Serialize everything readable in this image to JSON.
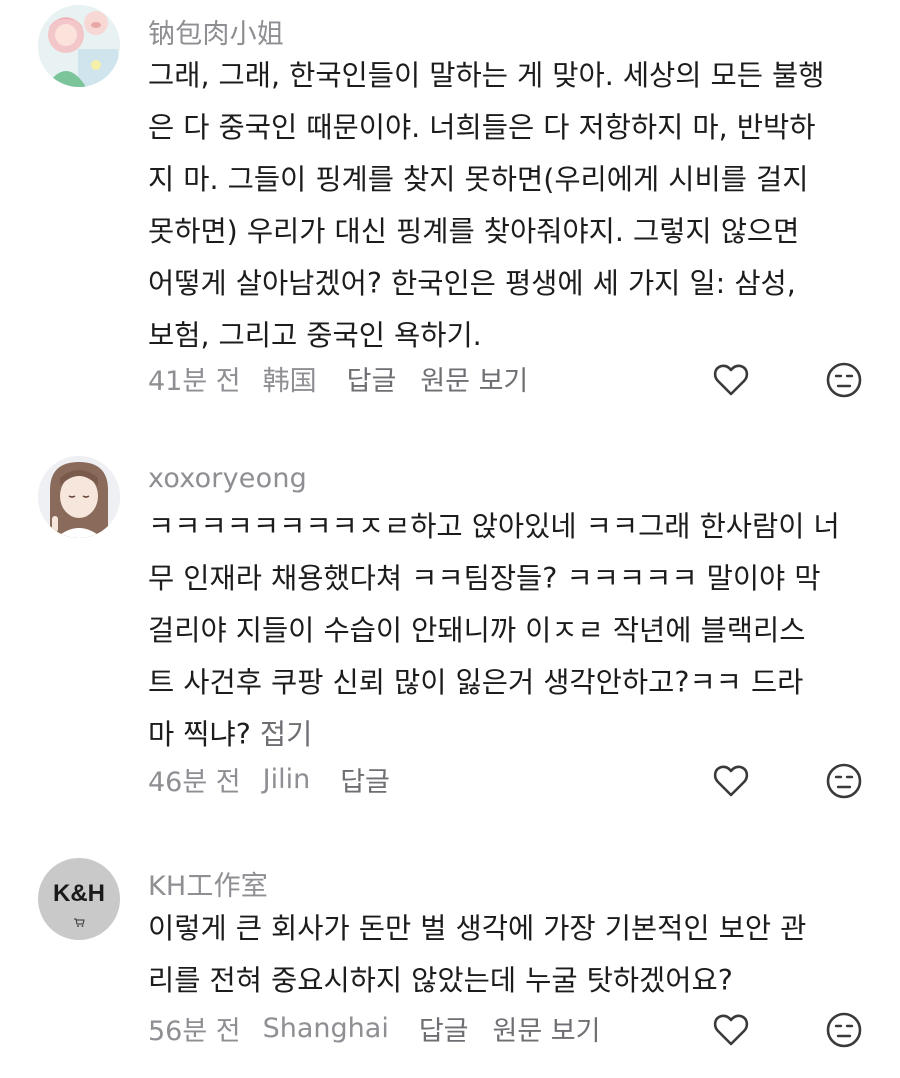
{
  "comments": [
    {
      "username": "钠包肉小姐",
      "lines": [
        "그래, 그래, 한국인들이 말하는 게 맞아. 세상의 모든 불행",
        "은 다 중국인 때문이야. 너희들은 다 저항하지 마, 반박하",
        "지 마. 그들이 핑계를 찾지 못하면(우리에게 시비를 걸지",
        "못하면) 우리가 대신 핑계를 찾아줘야지. 그렇지 않으면",
        "어떻게 살아남겠어? 한국인은 평생에 세 가지 일: 삼성,",
        "보험, 그리고 중국인 욕하기."
      ],
      "time": "41분 전",
      "location": "韩国",
      "reply": "답글",
      "original": "원문 보기"
    },
    {
      "username": "xoxoryeong",
      "lines": [
        "ㅋㅋㅋㅋㅋㅋㅋㅋㅈㄹ하고 앉아있네 ㅋㅋ그래 한사람이 너",
        "무 인재라 채용했다쳐 ㅋㅋ팀장들? ㅋㅋㅋㅋㅋ 말이야 막",
        "걸리야 지들이 수습이 안돼니까 이ㅈㄹ 작년에 블랙리스",
        "트 사건후 쿠팡 신뢰 많이 잃은거 생각안하고?ㅋㅋ 드라",
        "마 찍냐?"
      ],
      "fold": "접기",
      "time": "46분 전",
      "location": "Jilin",
      "reply": "답글"
    },
    {
      "username": "KH工作室",
      "avatar_text": "K&H",
      "lines": [
        "이렇게 큰 회사가 돈만 벌 생각에 가장 기본적인 보안 관",
        "리를 전혀 중요시하지 않았는데 누굴 탓하겠어요?"
      ],
      "time": "56분 전",
      "location": "Shanghai",
      "reply": "답글",
      "original": "원문 보기"
    }
  ],
  "icons": {
    "like": "heart-icon",
    "dislike": "meh-face-icon"
  },
  "colors": {
    "meta_text": "#8e8e93",
    "body_text": "#1c1c1e",
    "icon_stroke": "#3a3a3c"
  }
}
